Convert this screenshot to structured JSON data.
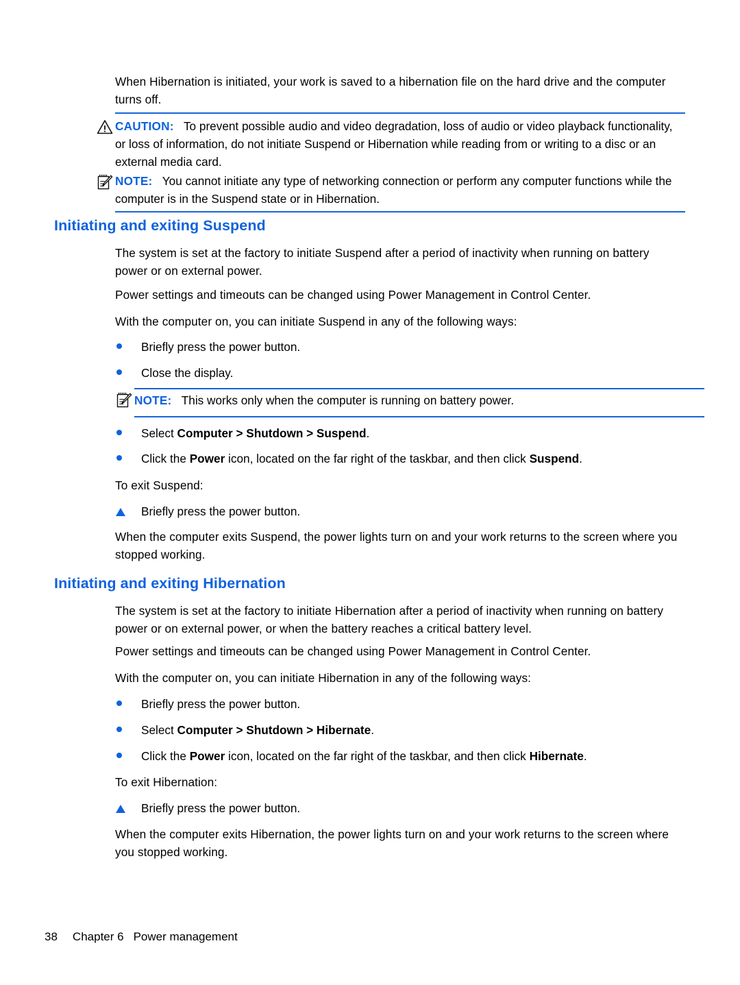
{
  "page": {
    "number": "38",
    "chapter_label": "Chapter 6",
    "chapter_title": "Power management"
  },
  "colors": {
    "accent_blue": "#0F62DE",
    "rule_blue": "#1565D8",
    "text_black": "#000000",
    "background": "#FFFFFF"
  },
  "intro": {
    "paragraph": "When Hibernation is initiated, your work is saved to a hibernation file on the hard drive and the computer turns off."
  },
  "caution": {
    "icon": "warning-triangle-icon",
    "label": "CAUTION:",
    "text": "To prevent possible audio and video degradation, loss of audio or video playback functionality, or loss of information, do not initiate Suspend or Hibernation while reading from or writing to a disc or an external media card."
  },
  "note_top": {
    "icon": "note-pad-pencil-icon",
    "label": "NOTE:",
    "text": "You cannot initiate any type of networking connection or perform any computer functions while the computer is in the Suspend state or in Hibernation."
  },
  "suspend_section": {
    "heading": "Initiating and exiting Suspend",
    "p1": "The system is set at the factory to initiate Suspend after a period of inactivity when running on battery power or on external power.",
    "p2": "Power settings and timeouts can be changed using Power Management in Control Center.",
    "p3": "With the computer on, you can initiate Suspend in any of the following ways:",
    "bullets_before_note": [
      {
        "marker": "bullet",
        "text": "Briefly press the power button."
      },
      {
        "marker": "bullet",
        "text": "Close the display."
      }
    ],
    "note": {
      "icon": "note-pad-pencil-icon",
      "label": "NOTE:",
      "text": "This works only when the computer is running on battery power."
    },
    "bullet_select": {
      "marker": "bullet",
      "prefix": "Select ",
      "bold": "Computer > Shutdown > Suspend",
      "suffix": "."
    },
    "bullet_power_icon": {
      "marker": "bullet",
      "part1": "Click the ",
      "bold1": "Power",
      "part2": " icon, located on the far right of the taskbar, and then click ",
      "bold2": "Suspend",
      "part3": "."
    },
    "exit_label": "To exit Suspend:",
    "exit_step": {
      "marker": "triangle",
      "text": "Briefly press the power button."
    },
    "closing": "When the computer exits Suspend, the power lights turn on and your work returns to the screen where you stopped working."
  },
  "hibernation_section": {
    "heading": "Initiating and exiting Hibernation",
    "p1": "The system is set at the factory to initiate Hibernation after a period of inactivity when running on battery power or on external power, or when the battery reaches a critical battery level.",
    "p2": "Power settings and timeouts can be changed using Power Management in Control Center.",
    "p3": "With the computer on, you can initiate Hibernation in any of the following ways:",
    "bullet_power_button": {
      "marker": "bullet",
      "text": "Briefly press the power button."
    },
    "bullet_select": {
      "marker": "bullet",
      "prefix": "Select ",
      "bold": "Computer > Shutdown > Hibernate",
      "suffix": "."
    },
    "bullet_power_icon": {
      "marker": "bullet",
      "part1": "Click the ",
      "bold1": "Power",
      "part2": " icon, located on the far right of the taskbar, and then click ",
      "bold2": "Hibernate",
      "part3": "."
    },
    "exit_label": "To exit Hibernation:",
    "exit_step": {
      "marker": "triangle",
      "text": "Briefly press the power button."
    },
    "closing": "When the computer exits Hibernation, the power lights turn on and your work returns to the screen where you stopped working."
  }
}
